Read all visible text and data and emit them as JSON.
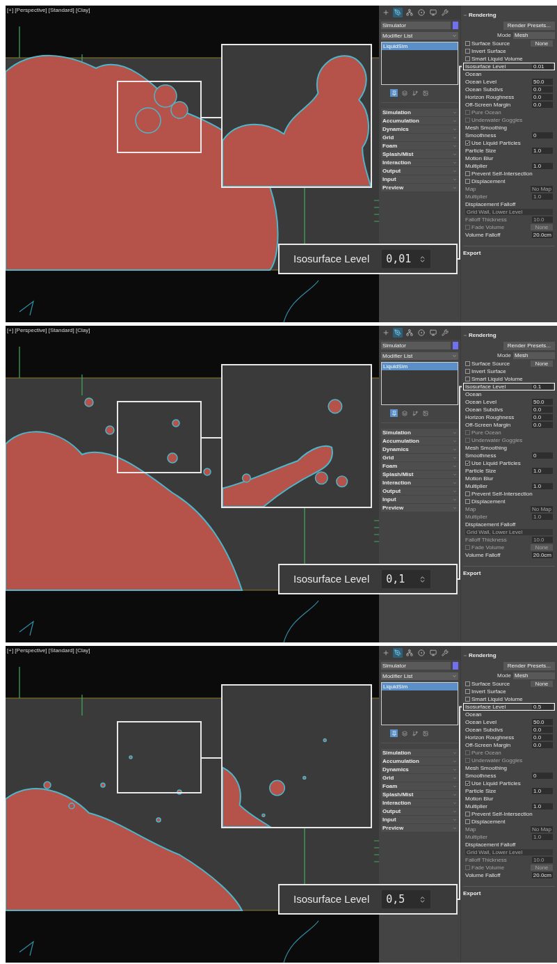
{
  "panels": [
    {
      "viewport": {
        "label": "[+] [Perspective] [Standard] [Clay]"
      },
      "callout": {
        "label": "Isosurface Level",
        "value": "0,01"
      },
      "command_panel": {
        "toolbar": [
          {
            "selected": false
          },
          {
            "selected": true
          },
          {
            "selected": false
          },
          {
            "selected": false
          },
          {
            "selected": false
          },
          {
            "selected": false
          }
        ],
        "object_name": "Simulator",
        "modifier_list": "Modifier List",
        "stack": [
          {
            "label": "LiquidSim",
            "selected": true
          }
        ],
        "stack_tools": [
          {
            "selected": true
          },
          {
            "selected": false
          },
          {
            "selected": false
          },
          {
            "selected": false
          }
        ],
        "rollouts": [
          "Simulation",
          "Accumulation",
          "Dynamics",
          "Grid",
          "Foam",
          "Splash/Mist",
          "Interaction",
          "Output",
          "Input",
          "Preview"
        ],
        "rendering": {
          "title": "Rendering",
          "preset_button": "Render Presets...",
          "mode_label": "Mode",
          "mode_value": "Mesh",
          "rows": [
            {
              "kind": "check",
              "label": "Surface Source",
              "checked": false,
              "value": "None",
              "disabled": false,
              "highlighted": false
            },
            {
              "kind": "check",
              "label": "Invert Surface",
              "checked": false,
              "disabled": false,
              "highlighted": false
            },
            {
              "kind": "check",
              "label": "Smart Liquid Volume",
              "checked": false,
              "disabled": false,
              "highlighted": false
            },
            {
              "kind": "field",
              "label": "Isosurface Level",
              "value": "0.01",
              "disabled": false,
              "highlighted": true
            },
            {
              "kind": "heading",
              "label": "Ocean",
              "disabled": false,
              "highlighted": false
            },
            {
              "kind": "field",
              "label": "Ocean Level",
              "value": "50.0",
              "disabled": false,
              "highlighted": false
            },
            {
              "kind": "field",
              "label": "Ocean Subdivs",
              "value": "0.0",
              "disabled": false,
              "highlighted": false
            },
            {
              "kind": "field",
              "label": "Horizon Roughness",
              "value": "0.0",
              "disabled": false,
              "highlighted": false
            },
            {
              "kind": "field",
              "label": "Off-Screen Margin",
              "value": "0.0",
              "disabled": false,
              "highlighted": false
            },
            {
              "kind": "check",
              "label": "Pure Ocean",
              "checked": false,
              "disabled": true,
              "highlighted": false
            },
            {
              "kind": "check",
              "label": "Underwater Goggles",
              "checked": false,
              "disabled": true,
              "highlighted": false
            },
            {
              "kind": "heading",
              "label": "Mesh Smoothing",
              "disabled": false,
              "highlighted": false
            },
            {
              "kind": "field",
              "label": "Smoothness",
              "value": "0",
              "disabled": false,
              "highlighted": false
            },
            {
              "kind": "check",
              "label": "Use Liquid Particles",
              "checked": true,
              "disabled": false,
              "highlighted": false
            },
            {
              "kind": "field",
              "label": "Particle Size",
              "value": "1.0",
              "disabled": false,
              "highlighted": false
            },
            {
              "kind": "heading",
              "label": "Motion Blur",
              "disabled": false,
              "highlighted": false
            },
            {
              "kind": "field",
              "label": "Multiplier",
              "value": "1.0",
              "disabled": false,
              "highlighted": false
            },
            {
              "kind": "check",
              "label": "Prevent Self-Intersection",
              "checked": false,
              "disabled": false,
              "highlighted": false
            },
            {
              "kind": "check",
              "label": "Displacement",
              "checked": false,
              "disabled": false,
              "highlighted": false
            },
            {
              "kind": "field",
              "label": "Map",
              "value": "No Map",
              "disabled": true,
              "highlighted": false
            },
            {
              "kind": "field",
              "label": "Multiplier",
              "value": "1.0",
              "disabled": true,
              "highlighted": false
            },
            {
              "kind": "heading",
              "label": "Displacement Falloff",
              "disabled": false,
              "highlighted": false
            },
            {
              "kind": "dropdown",
              "value": "Grid Wall, Lower Level",
              "disabled": true,
              "highlighted": false
            },
            {
              "kind": "field",
              "label": "Falloff Thickness",
              "value": "10.0",
              "disabled": true,
              "highlighted": false
            },
            {
              "kind": "check",
              "label": "Fade Volume",
              "checked": false,
              "value": "None",
              "disabled": true,
              "highlighted": false
            },
            {
              "kind": "field",
              "label": "Volume Falloff",
              "value": "20.0cm",
              "disabled": false,
              "highlighted": false
            }
          ]
        },
        "export": "Export"
      }
    },
    {
      "viewport": {
        "label": "[+] [Perspective] [Standard] [Clay]"
      },
      "callout": {
        "label": "Isosurface Level",
        "value": "0,1"
      },
      "command_panel": {
        "toolbar": [
          {
            "selected": false
          },
          {
            "selected": true
          },
          {
            "selected": false
          },
          {
            "selected": false
          },
          {
            "selected": false
          },
          {
            "selected": false
          }
        ],
        "object_name": "Simulator",
        "modifier_list": "Modifier List",
        "stack": [
          {
            "label": "LiquidSim",
            "selected": true
          }
        ],
        "stack_tools": [
          {
            "selected": true
          },
          {
            "selected": false
          },
          {
            "selected": false
          },
          {
            "selected": false
          }
        ],
        "rollouts": [
          "Simulation",
          "Accumulation",
          "Dynamics",
          "Grid",
          "Foam",
          "Splash/Mist",
          "Interaction",
          "Output",
          "Input",
          "Preview"
        ],
        "rendering": {
          "title": "Rendering",
          "preset_button": "Render Presets...",
          "mode_label": "Mode",
          "mode_value": "Mesh",
          "rows": [
            {
              "kind": "check",
              "label": "Surface Source",
              "checked": false,
              "value": "None",
              "disabled": false,
              "highlighted": false
            },
            {
              "kind": "check",
              "label": "Invert Surface",
              "checked": false,
              "disabled": false,
              "highlighted": false
            },
            {
              "kind": "check",
              "label": "Smart Liquid Volume",
              "checked": false,
              "disabled": false,
              "highlighted": false
            },
            {
              "kind": "field",
              "label": "Isosurface Level",
              "value": "0.1",
              "disabled": false,
              "highlighted": true
            },
            {
              "kind": "heading",
              "label": "Ocean",
              "disabled": false,
              "highlighted": false
            },
            {
              "kind": "field",
              "label": "Ocean Level",
              "value": "50.0",
              "disabled": false,
              "highlighted": false
            },
            {
              "kind": "field",
              "label": "Ocean Subdivs",
              "value": "0.0",
              "disabled": false,
              "highlighted": false
            },
            {
              "kind": "field",
              "label": "Horizon Roughness",
              "value": "0.0",
              "disabled": false,
              "highlighted": false
            },
            {
              "kind": "field",
              "label": "Off-Screen Margin",
              "value": "0.0",
              "disabled": false,
              "highlighted": false
            },
            {
              "kind": "check",
              "label": "Pure Ocean",
              "checked": false,
              "disabled": true,
              "highlighted": false
            },
            {
              "kind": "check",
              "label": "Underwater Goggles",
              "checked": false,
              "disabled": true,
              "highlighted": false
            },
            {
              "kind": "heading",
              "label": "Mesh Smoothing",
              "disabled": false,
              "highlighted": false
            },
            {
              "kind": "field",
              "label": "Smoothness",
              "value": "0",
              "disabled": false,
              "highlighted": false
            },
            {
              "kind": "check",
              "label": "Use Liquid Particles",
              "checked": true,
              "disabled": false,
              "highlighted": false
            },
            {
              "kind": "field",
              "label": "Particle Size",
              "value": "1.0",
              "disabled": false,
              "highlighted": false
            },
            {
              "kind": "heading",
              "label": "Motion Blur",
              "disabled": false,
              "highlighted": false
            },
            {
              "kind": "field",
              "label": "Multiplier",
              "value": "1.0",
              "disabled": false,
              "highlighted": false
            },
            {
              "kind": "check",
              "label": "Prevent Self-Intersection",
              "checked": false,
              "disabled": false,
              "highlighted": false
            },
            {
              "kind": "check",
              "label": "Displacement",
              "checked": false,
              "disabled": false,
              "highlighted": false
            },
            {
              "kind": "field",
              "label": "Map",
              "value": "No Map",
              "disabled": true,
              "highlighted": false
            },
            {
              "kind": "field",
              "label": "Multiplier",
              "value": "1.0",
              "disabled": true,
              "highlighted": false
            },
            {
              "kind": "heading",
              "label": "Displacement Falloff",
              "disabled": false,
              "highlighted": false
            },
            {
              "kind": "dropdown",
              "value": "Grid Wall, Lower Level",
              "disabled": true,
              "highlighted": false
            },
            {
              "kind": "field",
              "label": "Falloff Thickness",
              "value": "10.0",
              "disabled": true,
              "highlighted": false
            },
            {
              "kind": "check",
              "label": "Fade Volume",
              "checked": false,
              "value": "None",
              "disabled": true,
              "highlighted": false
            },
            {
              "kind": "field",
              "label": "Volume Falloff",
              "value": "20.0cm",
              "disabled": false,
              "highlighted": false
            }
          ]
        },
        "export": "Export"
      }
    },
    {
      "viewport": {
        "label": "[+] [Perspective] [Standard] [Clay]"
      },
      "callout": {
        "label": "Isosurface Level",
        "value": "0,5"
      },
      "command_panel": {
        "toolbar": [
          {
            "selected": false
          },
          {
            "selected": true
          },
          {
            "selected": false
          },
          {
            "selected": false
          },
          {
            "selected": false
          },
          {
            "selected": false
          }
        ],
        "object_name": "Simulator",
        "modifier_list": "Modifier List",
        "stack": [
          {
            "label": "LiquidSim",
            "selected": true
          }
        ],
        "stack_tools": [
          {
            "selected": true
          },
          {
            "selected": false
          },
          {
            "selected": false
          },
          {
            "selected": false
          }
        ],
        "rollouts": [
          "Simulation",
          "Accumulation",
          "Dynamics",
          "Grid",
          "Foam",
          "Splash/Mist",
          "Interaction",
          "Output",
          "Input",
          "Preview"
        ],
        "rendering": {
          "title": "Rendering",
          "preset_button": "Render Presets...",
          "mode_label": "Mode",
          "mode_value": "Mesh",
          "rows": [
            {
              "kind": "check",
              "label": "Surface Source",
              "checked": false,
              "value": "None",
              "disabled": false,
              "highlighted": false
            },
            {
              "kind": "check",
              "label": "Invert Surface",
              "checked": false,
              "disabled": false,
              "highlighted": false
            },
            {
              "kind": "check",
              "label": "Smart Liquid Volume",
              "checked": false,
              "disabled": false,
              "highlighted": false
            },
            {
              "kind": "field",
              "label": "Isosurface Level",
              "value": "0.5",
              "disabled": false,
              "highlighted": true
            },
            {
              "kind": "heading",
              "label": "Ocean",
              "disabled": false,
              "highlighted": false
            },
            {
              "kind": "field",
              "label": "Ocean Level",
              "value": "50.0",
              "disabled": false,
              "highlighted": false
            },
            {
              "kind": "field",
              "label": "Ocean Subdivs",
              "value": "0.0",
              "disabled": false,
              "highlighted": false
            },
            {
              "kind": "field",
              "label": "Horizon Roughness",
              "value": "0.0",
              "disabled": false,
              "highlighted": false
            },
            {
              "kind": "field",
              "label": "Off-Screen Margin",
              "value": "0.0",
              "disabled": false,
              "highlighted": false
            },
            {
              "kind": "check",
              "label": "Pure Ocean",
              "checked": false,
              "disabled": true,
              "highlighted": false
            },
            {
              "kind": "check",
              "label": "Underwater Goggles",
              "checked": false,
              "disabled": true,
              "highlighted": false
            },
            {
              "kind": "heading",
              "label": "Mesh Smoothing",
              "disabled": false,
              "highlighted": false
            },
            {
              "kind": "field",
              "label": "Smoothness",
              "value": "0",
              "disabled": false,
              "highlighted": false
            },
            {
              "kind": "check",
              "label": "Use Liquid Particles",
              "checked": true,
              "disabled": false,
              "highlighted": false
            },
            {
              "kind": "field",
              "label": "Particle Size",
              "value": "1.0",
              "disabled": false,
              "highlighted": false
            },
            {
              "kind": "heading",
              "label": "Motion Blur",
              "disabled": false,
              "highlighted": false
            },
            {
              "kind": "field",
              "label": "Multiplier",
              "value": "1.0",
              "disabled": false,
              "highlighted": false
            },
            {
              "kind": "check",
              "label": "Prevent Self-Intersection",
              "checked": false,
              "disabled": false,
              "highlighted": false
            },
            {
              "kind": "check",
              "label": "Displacement",
              "checked": false,
              "disabled": false,
              "highlighted": false
            },
            {
              "kind": "field",
              "label": "Map",
              "value": "No Map",
              "disabled": true,
              "highlighted": false
            },
            {
              "kind": "field",
              "label": "Multiplier",
              "value": "1.0",
              "disabled": true,
              "highlighted": false
            },
            {
              "kind": "heading",
              "label": "Displacement Falloff",
              "disabled": false,
              "highlighted": false
            },
            {
              "kind": "dropdown",
              "value": "Grid Wall, Lower Level",
              "disabled": true,
              "highlighted": false
            },
            {
              "kind": "field",
              "label": "Falloff Thickness",
              "value": "10.0",
              "disabled": true,
              "highlighted": false
            },
            {
              "kind": "check",
              "label": "Fade Volume",
              "checked": false,
              "value": "None",
              "disabled": true,
              "highlighted": false
            },
            {
              "kind": "field",
              "label": "Volume Falloff",
              "value": "20.0cm",
              "disabled": false,
              "highlighted": false
            }
          ]
        },
        "export": "Export"
      }
    }
  ]
}
